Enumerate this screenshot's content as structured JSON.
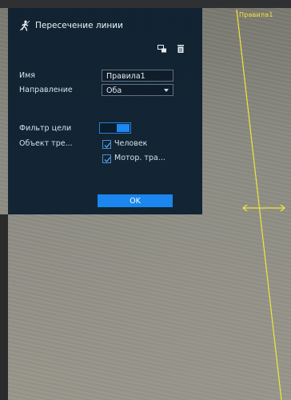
{
  "video": {
    "rule_label": "Правила1"
  },
  "panel": {
    "title": "Пересечение линии",
    "title_icon": "person-crossing-icon",
    "toolbar": {
      "draw_icon": "draw-rule-icon",
      "delete_icon": "trash-icon"
    },
    "name_label": "Имя",
    "name_value": "Правила1",
    "direction_label": "Направление",
    "direction_value": "Оба",
    "target_filter_label": "Фильтр цели",
    "target_filter_on": true,
    "object_type_label": "Объект тре...",
    "objects": [
      {
        "label": "Человек",
        "checked": true
      },
      {
        "label": "Мотор. тра...",
        "checked": true
      }
    ],
    "ok_label": "OK"
  },
  "colors": {
    "accent": "#1a86ee",
    "rule_line": "#f0e63a",
    "panel_bg": "#0a1c2d"
  }
}
